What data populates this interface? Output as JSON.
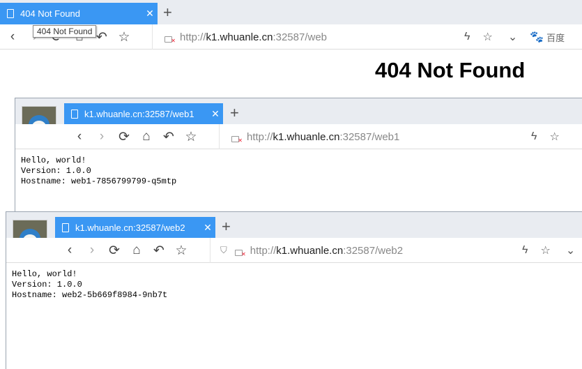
{
  "win_main": {
    "tab_title": "404 Not Found",
    "url_prefix": "http://",
    "url_host": "k1.whuanle.cn",
    "url_rest": ":32587/web",
    "search_engine": "百度",
    "tooltip": "404 Not Found",
    "heading": "404 Not Found"
  },
  "win_web1": {
    "tab_title": "k1.whuanle.cn:32587/web1",
    "url_prefix": "http://",
    "url_host": "k1.whuanle.cn",
    "url_rest": ":32587/web1",
    "body": "Hello, world!\nVersion: 1.0.0\nHostname: web1-7856799799-q5mtp"
  },
  "win_web2": {
    "tab_title": "k1.whuanle.cn:32587/web2",
    "url_prefix": "http://",
    "url_host": "k1.whuanle.cn",
    "url_rest": ":32587/web2",
    "body": "Hello, world!\nVersion: 1.0.0\nHostname: web2-5b669f8984-9nb7t"
  },
  "icons": {
    "back": "back-icon",
    "forward": "forward-icon",
    "reload": "reload-icon",
    "home": "home-icon",
    "undo": "undo-icon",
    "star": "star-icon",
    "lightning": "lightning-icon",
    "chevron": "chevron-down-icon",
    "shield": "shield-icon",
    "paw": "paw-icon"
  },
  "colors": {
    "tab_active": "#3a97f3",
    "tabstrip": "#e9ecf1"
  }
}
